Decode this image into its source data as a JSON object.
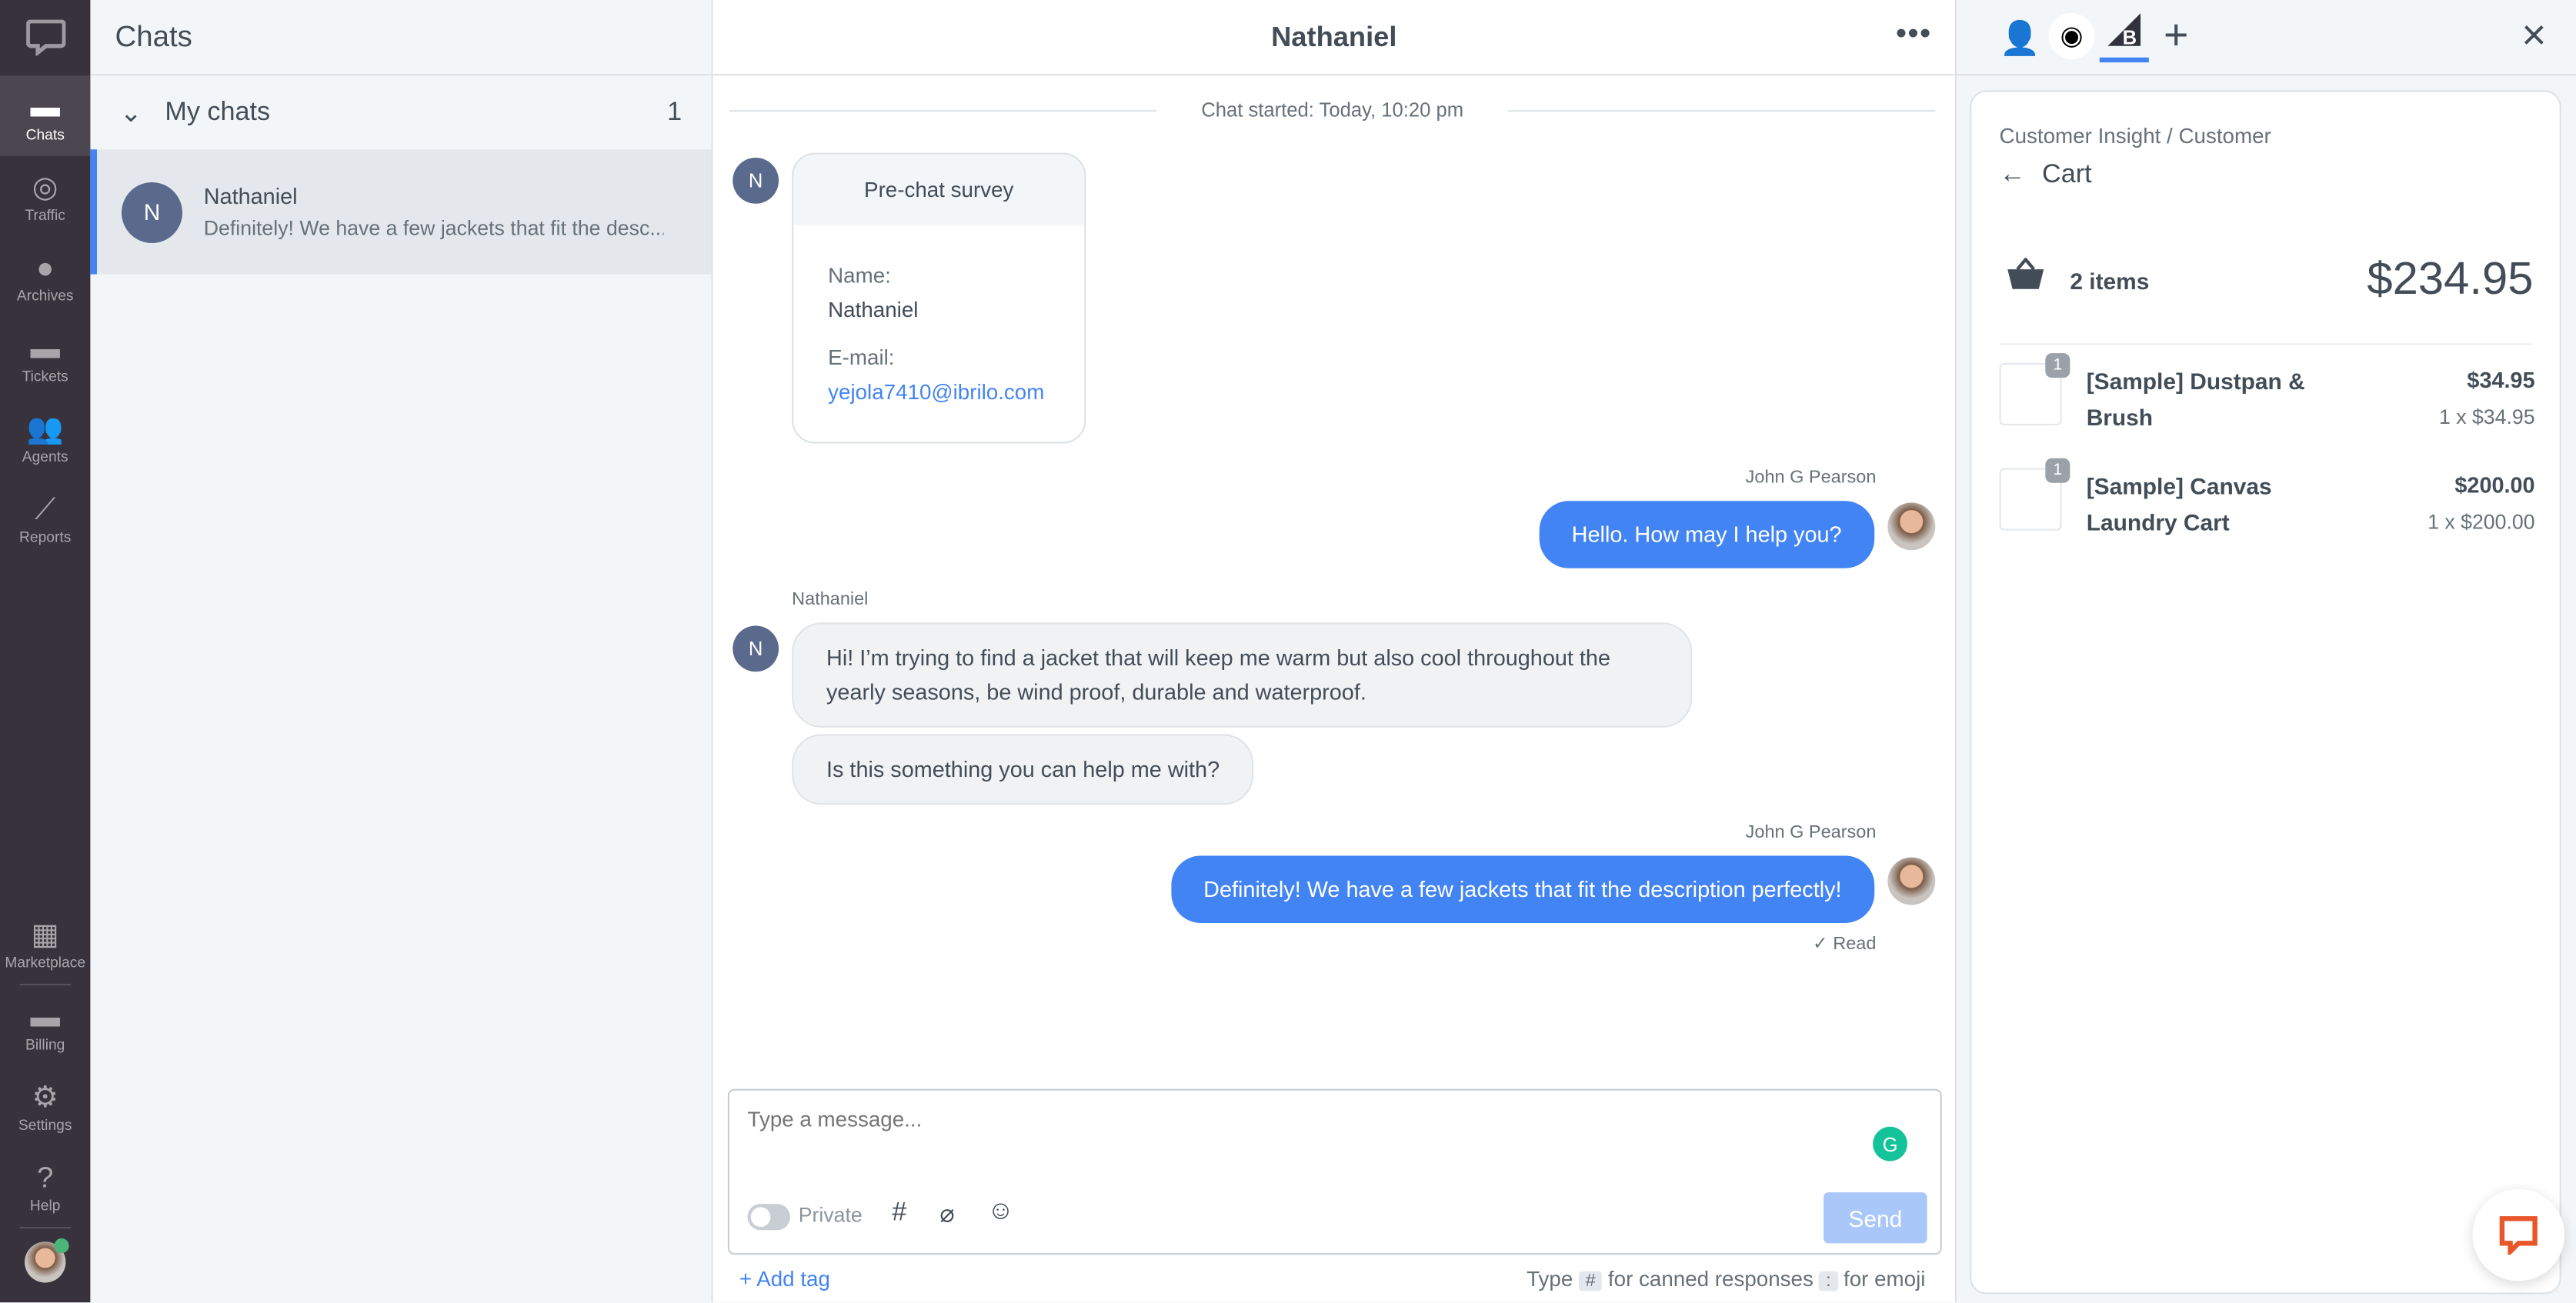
{
  "nav": {
    "items": [
      {
        "label": "Chats",
        "icon": "chats-icon"
      },
      {
        "label": "Traffic",
        "icon": "traffic-icon"
      },
      {
        "label": "Archives",
        "icon": "clock-icon"
      },
      {
        "label": "Tickets",
        "icon": "ticket-icon"
      },
      {
        "label": "Agents",
        "icon": "agents-icon"
      },
      {
        "label": "Reports",
        "icon": "chart-line-icon"
      }
    ],
    "bottom": [
      {
        "label": "Marketplace",
        "icon": "grid-icon"
      },
      {
        "label": "Billing",
        "icon": "card-icon"
      },
      {
        "label": "Settings",
        "icon": "gear-icon"
      },
      {
        "label": "Help",
        "icon": "help-icon"
      }
    ]
  },
  "list": {
    "title": "Chats",
    "group": "My chats",
    "group_count": "1",
    "chat": {
      "initial": "N",
      "name": "Nathaniel",
      "preview": "Definitely! We have a few jackets that fit the desc..."
    }
  },
  "main": {
    "title": "Nathaniel",
    "started": "Chat started: Today, 10:20 pm",
    "survey": {
      "title": "Pre-chat survey",
      "name_label": "Name:",
      "name": "Nathaniel",
      "email_label": "E-mail:",
      "email": "yejola7410@ibrilo.com"
    },
    "messages": [
      {
        "author": "John G Pearson",
        "text": "Hello. How may I help you?"
      },
      {
        "author": "Nathaniel",
        "text": "Hi! I’m trying to find a jacket that will keep me warm but also cool throughout the yearly seasons, be wind proof, durable and waterproof."
      },
      {
        "text": "Is this something you can help me with?"
      },
      {
        "author": "John G Pearson",
        "text": "Definitely! We have a few jackets that fit the description perfectly!"
      }
    ],
    "read": "✓ Read",
    "composer": {
      "placeholder": "Type a message...",
      "private": "Private",
      "send": "Send"
    },
    "add_tag": "+ Add tag",
    "hint1": "Type",
    "hint_key1": "#",
    "hint2": "for canned responses",
    "hint_key2": ":",
    "hint3": "for emoji"
  },
  "side": {
    "breadcrumb": "Customer Insight / Customer",
    "title": "Cart",
    "items_count": "2 items",
    "total": "$234.95",
    "products": [
      {
        "name": "[Sample] Dustpan & Brush",
        "price": "$34.95",
        "qty_line": "1 x $34.95",
        "qty": "1"
      },
      {
        "name": "[Sample] Canvas Laundry Cart",
        "price": "$200.00",
        "qty_line": "1 x $200.00",
        "qty": "1"
      }
    ]
  },
  "colors": {
    "accent": "#4384f5",
    "nav_bg": "#37323b",
    "send_disabled": "#a9c7f9"
  }
}
